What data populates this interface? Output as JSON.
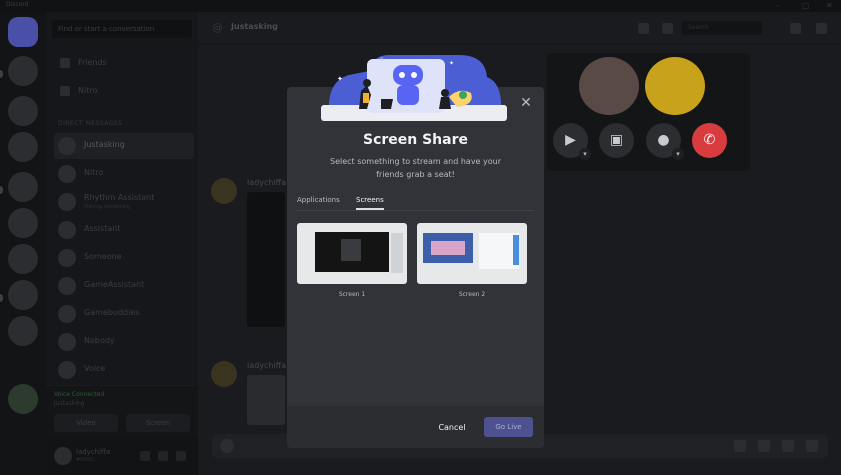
{
  "window": {
    "app_name": "Discord",
    "controls": [
      "–",
      "▢",
      "✕"
    ]
  },
  "sidebar": {
    "search_placeholder": "Find or start a conversation",
    "nav": [
      {
        "label": "Friends",
        "icon": "friends-icon"
      },
      {
        "label": "Nitro",
        "icon": "nitro-icon"
      }
    ],
    "dm_header": "DIRECT MESSAGES",
    "dms": [
      {
        "name": "Justasking",
        "sub": "",
        "active": true
      },
      {
        "name": "Nitro",
        "sub": ""
      },
      {
        "name": "Rhythm Assistant",
        "sub": "Playing something"
      },
      {
        "name": "Assistant",
        "sub": ""
      },
      {
        "name": "Someone",
        "sub": ""
      },
      {
        "name": "GameAssistant",
        "sub": ""
      },
      {
        "name": "Gamebuddies",
        "sub": ""
      },
      {
        "name": "Nobody",
        "sub": ""
      },
      {
        "name": "Voice",
        "sub": ""
      }
    ],
    "voice": {
      "status": "Voice Connected",
      "channel": "Justasking",
      "video_label": "Video",
      "screen_label": "Screen"
    },
    "user": {
      "name": "ladychiffa",
      "tag": "#0000"
    }
  },
  "channel": {
    "name": "Justasking",
    "search_placeholder": "Search"
  },
  "messages": [
    {
      "author": "ladychiffa"
    },
    {
      "author": "ladychiffa"
    }
  ],
  "call": {
    "buttons": [
      {
        "name": "camera",
        "glyph": "▶"
      },
      {
        "name": "share-screen",
        "glyph": "▣"
      },
      {
        "name": "mic",
        "glyph": "●"
      },
      {
        "name": "end-call",
        "glyph": "✆"
      }
    ]
  },
  "modal": {
    "title": "Screen Share",
    "subtitle": "Select something to stream and have your friends grab a seat!",
    "tabs": [
      {
        "label": "Applications",
        "selected": false
      },
      {
        "label": "Screens",
        "selected": true
      }
    ],
    "screens": [
      {
        "label": "Screen 1"
      },
      {
        "label": "Screen 2"
      }
    ],
    "cancel_label": "Cancel",
    "go_live_label": "Go Live"
  },
  "colors": {
    "blurple": "#5865f2",
    "end_call": "#d83c3e",
    "modal_bg": "#313338",
    "go_live_disabled": "#4e5190"
  }
}
